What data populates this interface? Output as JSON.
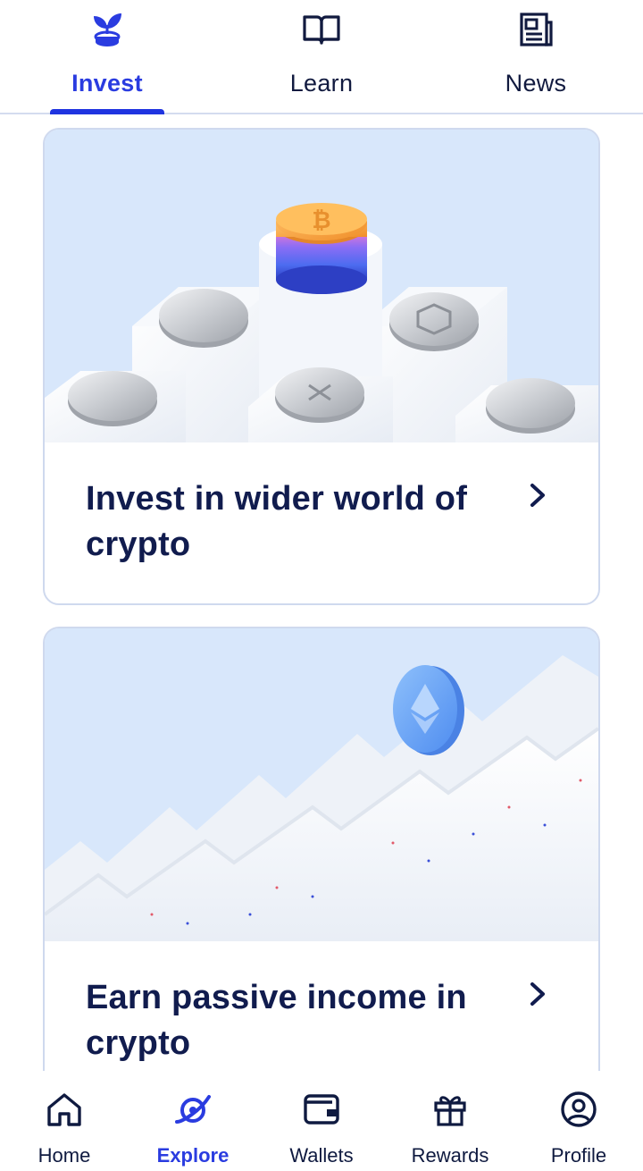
{
  "top_tabs": [
    {
      "label": "Invest",
      "icon": "sprout-coin-icon",
      "active": true
    },
    {
      "label": "Learn",
      "icon": "open-book-icon",
      "active": false
    },
    {
      "label": "News",
      "icon": "newspaper-icon",
      "active": false
    }
  ],
  "cards": [
    {
      "title": "Invest in wider world of crypto",
      "image": "coins-on-pedestals-illustration"
    },
    {
      "title": "Earn passive income in crypto",
      "image": "ethereum-coin-on-zigzag-illustration"
    }
  ],
  "bottom_nav": [
    {
      "label": "Home",
      "icon": "home-icon",
      "active": false
    },
    {
      "label": "Explore",
      "icon": "explore-icon",
      "active": true
    },
    {
      "label": "Wallets",
      "icon": "wallet-icon",
      "active": false
    },
    {
      "label": "Rewards",
      "icon": "gift-icon",
      "active": false
    },
    {
      "label": "Profile",
      "icon": "profile-icon",
      "active": false
    }
  ],
  "colors": {
    "accent": "#2a3ce0",
    "text_dark": "#111c4e",
    "card_border": "#cfd9ee",
    "hero_bg": "#d8e7fb"
  }
}
